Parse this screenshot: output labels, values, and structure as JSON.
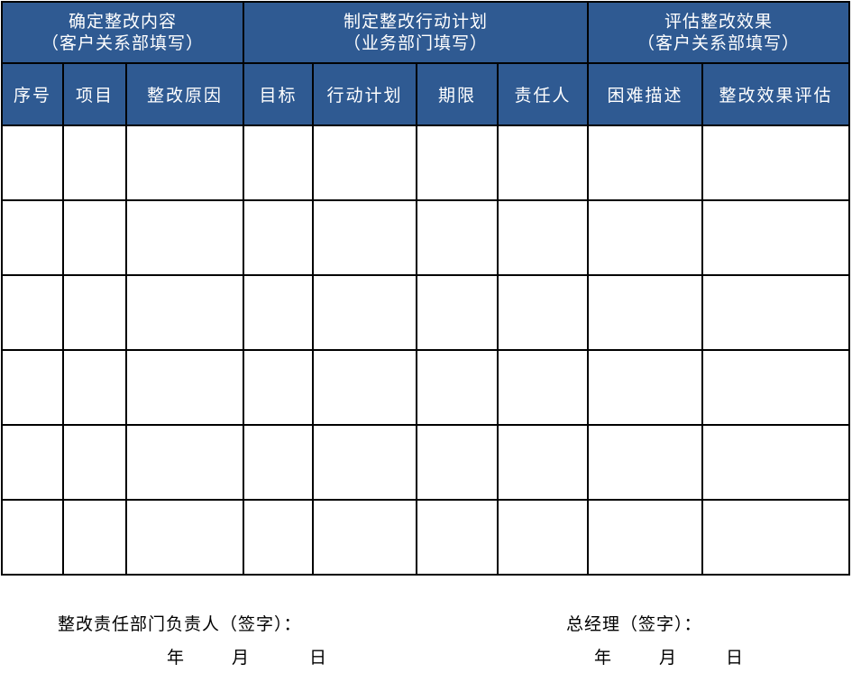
{
  "form": {
    "groups": [
      {
        "title": "确定整改内容",
        "subtitle": "（客户关系部填写）"
      },
      {
        "title": "制定整改行动计划",
        "subtitle": "（业务部门填写）"
      },
      {
        "title": "评估整改效果",
        "subtitle": "（客户关系部填写）"
      }
    ],
    "columns": [
      {
        "label": "序号"
      },
      {
        "label": "项目"
      },
      {
        "label": "整改原因"
      },
      {
        "label": "目标"
      },
      {
        "label": "行动计划"
      },
      {
        "label": "期限"
      },
      {
        "label": "责任人"
      },
      {
        "label": "困难描述"
      },
      {
        "label": "整改效果评估"
      }
    ],
    "rows": [
      [
        "",
        "",
        "",
        "",
        "",
        "",
        "",
        "",
        ""
      ],
      [
        "",
        "",
        "",
        "",
        "",
        "",
        "",
        "",
        ""
      ],
      [
        "",
        "",
        "",
        "",
        "",
        "",
        "",
        "",
        ""
      ],
      [
        "",
        "",
        "",
        "",
        "",
        "",
        "",
        "",
        ""
      ],
      [
        "",
        "",
        "",
        "",
        "",
        "",
        "",
        "",
        ""
      ],
      [
        "",
        "",
        "",
        "",
        "",
        "",
        "",
        "",
        ""
      ]
    ]
  },
  "footer": {
    "left_sign_label": "整改责任部门负责人（签字）：",
    "right_sign_label": "总经理（签字）：",
    "year": "年",
    "month": "月",
    "day": "日"
  },
  "colors": {
    "header_bg": "#2f5a92",
    "header_text": "#ffffff",
    "border": "#000000"
  }
}
